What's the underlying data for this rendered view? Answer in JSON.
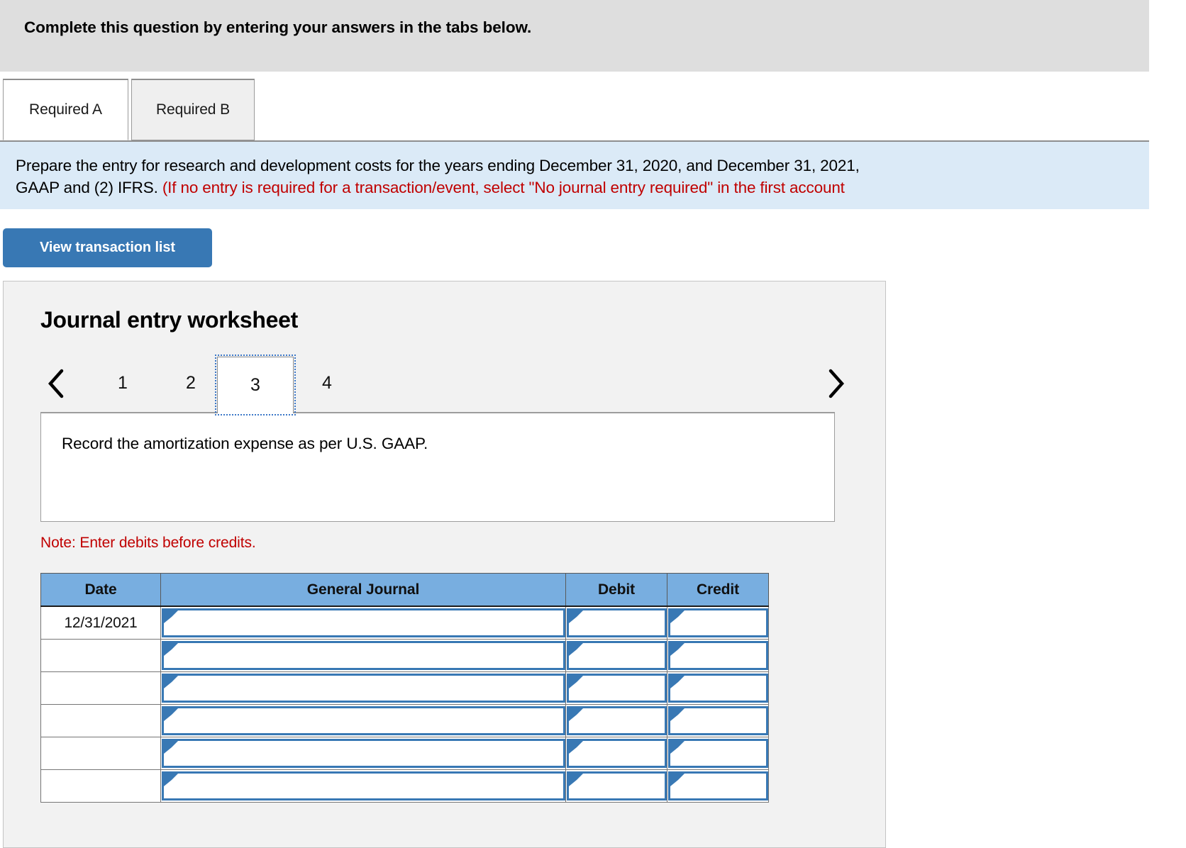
{
  "banner": {
    "text": "Complete this question by entering your answers in the tabs below."
  },
  "tabs": [
    {
      "label": "Required A",
      "active": true
    },
    {
      "label": "Required B",
      "active": false
    }
  ],
  "prompt": {
    "line1": "Prepare the entry for research and development costs for the years ending December 31, 2020, and December 31, 2021,",
    "line2_black": "GAAP and (2) IFRS. ",
    "line2_red": "(If no entry is required for a transaction/event, select \"No journal entry required\" in the first account"
  },
  "toolbar": {
    "view_transaction_list_label": "View transaction list"
  },
  "worksheet": {
    "title": "Journal entry worksheet",
    "pager": {
      "prev_icon": "chevron-left-icon",
      "next_icon": "chevron-right-icon",
      "pages": [
        "1",
        "2",
        "3",
        "4"
      ],
      "selected": "3"
    },
    "description": "Record the amortization expense as per U.S. GAAP.",
    "note": "Note: Enter debits before credits.",
    "table": {
      "columns": [
        "Date",
        "General Journal",
        "Debit",
        "Credit"
      ],
      "rows": [
        {
          "date": "12/31/2021",
          "general_journal": "",
          "debit": "",
          "credit": ""
        },
        {
          "date": "",
          "general_journal": "",
          "debit": "",
          "credit": ""
        },
        {
          "date": "",
          "general_journal": "",
          "debit": "",
          "credit": ""
        },
        {
          "date": "",
          "general_journal": "",
          "debit": "",
          "credit": ""
        },
        {
          "date": "",
          "general_journal": "",
          "debit": "",
          "credit": ""
        },
        {
          "date": "",
          "general_journal": "",
          "debit": "",
          "credit": ""
        }
      ]
    }
  },
  "colors": {
    "banner_bg": "#dedede",
    "prompt_bg": "#dbeaf7",
    "accent_blue": "#3878b4",
    "table_header_blue": "#78aee0",
    "alert_red": "#c00000"
  }
}
